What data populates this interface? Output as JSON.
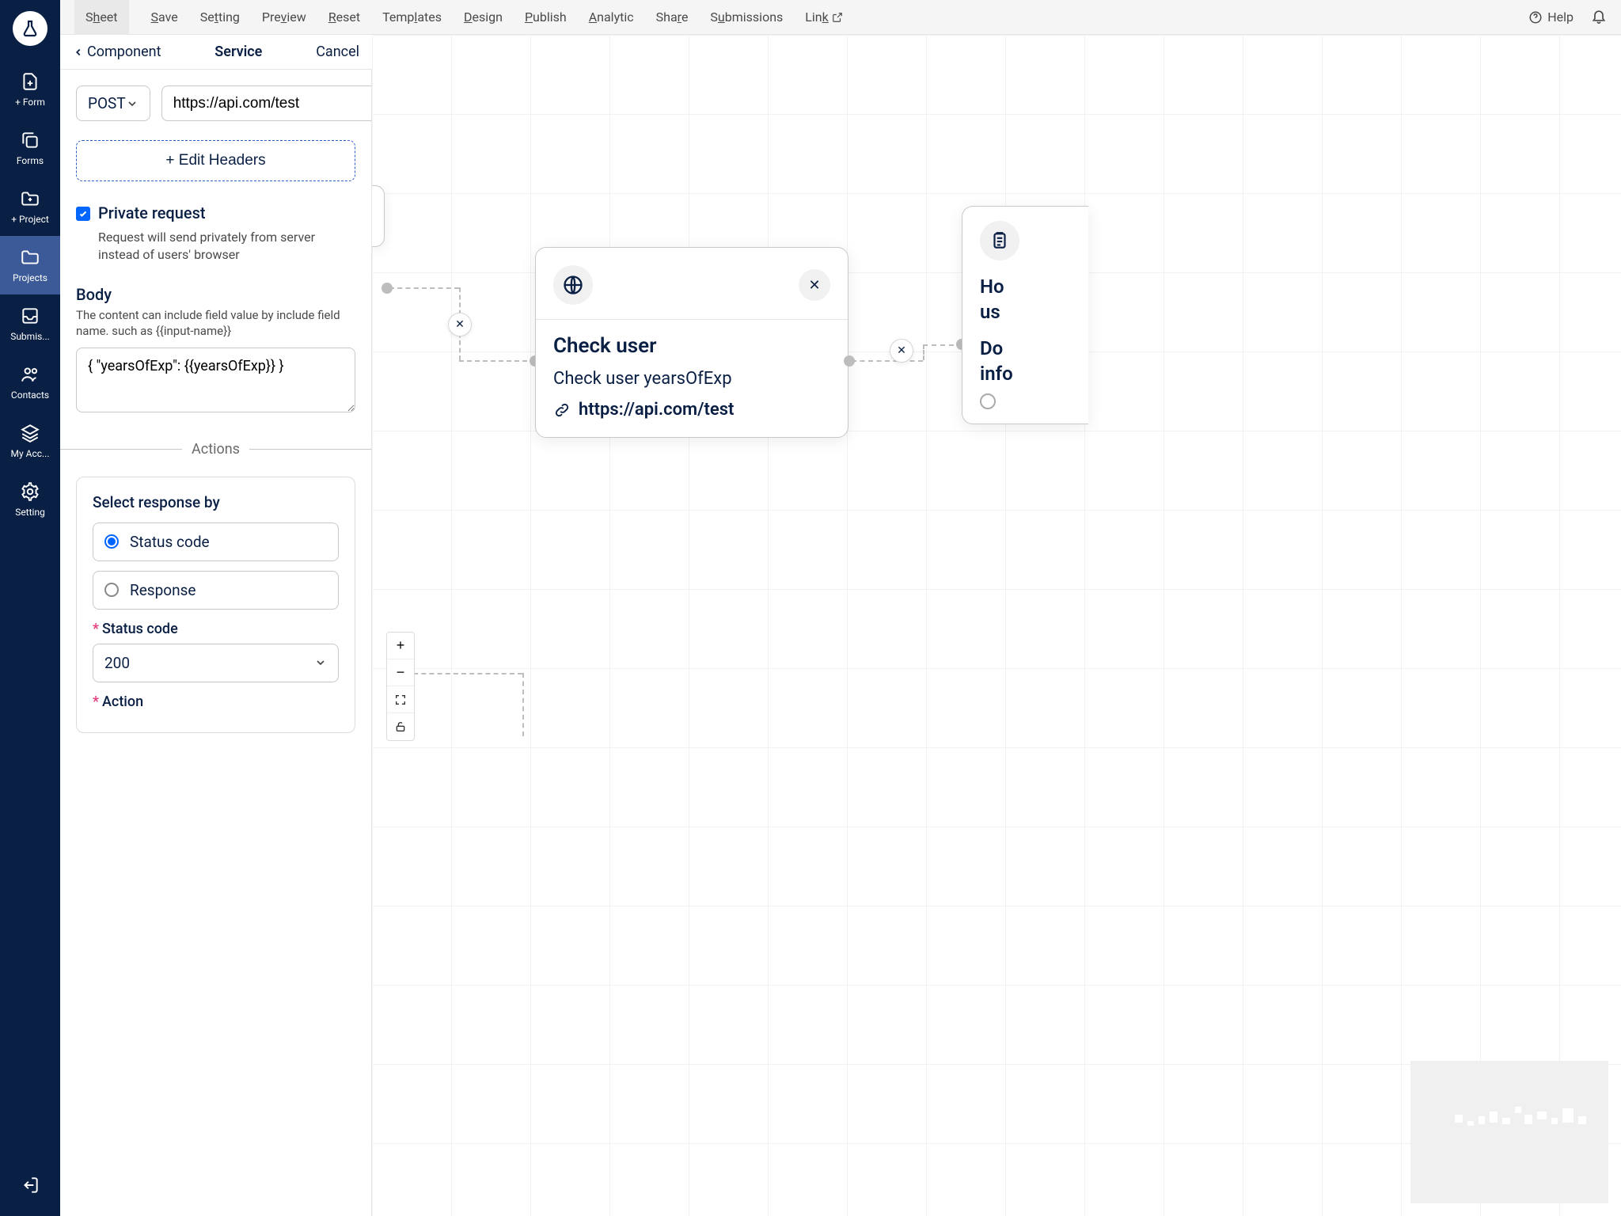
{
  "sidebar": {
    "items": [
      {
        "label": "+ Form"
      },
      {
        "label": "Forms"
      },
      {
        "label": "+ Project"
      },
      {
        "label": "Projects"
      },
      {
        "label": "Submis..."
      },
      {
        "label": "Contacts"
      },
      {
        "label": "My Acc..."
      },
      {
        "label": "Setting"
      }
    ]
  },
  "menubar": {
    "items": [
      "Sheet",
      "Save",
      "Setting",
      "Preview",
      "Reset",
      "Templates",
      "Design",
      "Publish",
      "Analytic",
      "Share",
      "Submissions"
    ],
    "link_label": "Link",
    "help_label": "Help"
  },
  "panel_header": {
    "back": "Component",
    "title": "Service",
    "cancel": "Cancel"
  },
  "service": {
    "method": "POST",
    "url": "https://api.com/test",
    "edit_headers": "+ Edit Headers",
    "private_label": "Private request",
    "private_help": "Request will send privately from server instead of users' browser",
    "body_label": "Body",
    "body_help": "The content can include field value by include field name. such as {{input-name}}",
    "body_value": "{ \"yearsOfExp\": {{yearsOfExp}} }",
    "actions_divider": "Actions",
    "select_response_by": "Select response by",
    "option_status": "Status code",
    "option_response": "Response",
    "status_code_label": "Status code",
    "status_code_value": "200",
    "action_label": "Action"
  },
  "canvas": {
    "node": {
      "title": "Check user",
      "subtitle": "Check user yearsOfExp",
      "url": "https://api.com/test"
    },
    "right_node": {
      "line1": "Ho",
      "line2": "us",
      "line3": "Do",
      "line4": "info"
    }
  }
}
